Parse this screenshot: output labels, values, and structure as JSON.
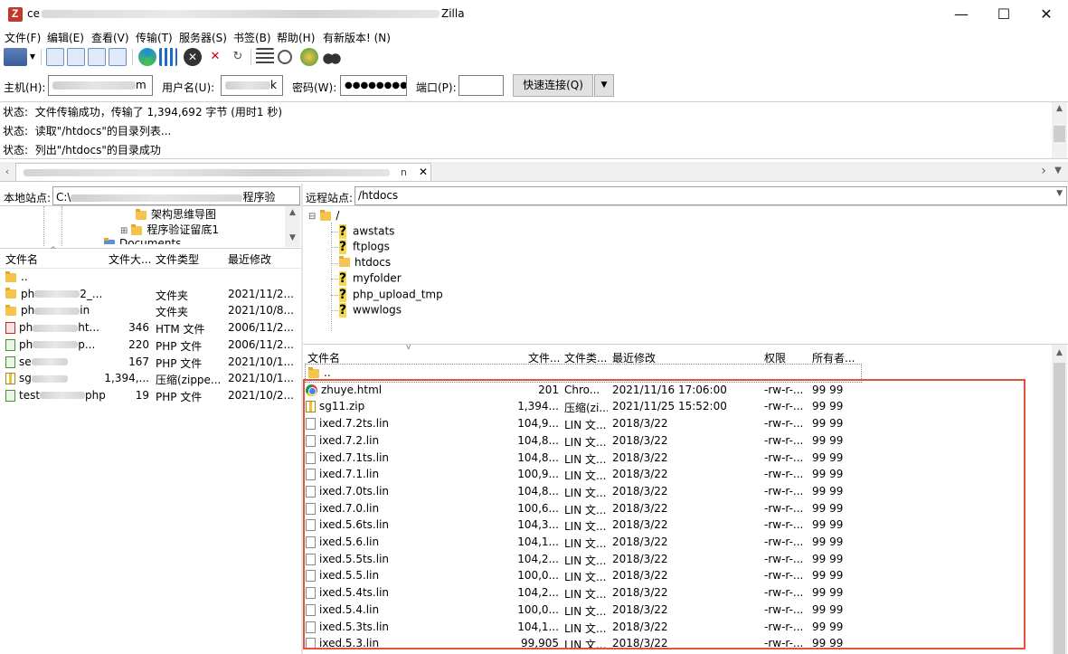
{
  "window": {
    "title_start": "ce",
    "title_end": "Zilla",
    "minimize": "—",
    "maximize": "☐",
    "close": "✕"
  },
  "menu": [
    {
      "label": "文件(F)"
    },
    {
      "label": "编辑(E)"
    },
    {
      "label": "查看(V)"
    },
    {
      "label": "传输(T)"
    },
    {
      "label": "服务器(S)"
    },
    {
      "label": "书签(B)"
    },
    {
      "label": "帮助(H)"
    },
    {
      "label": "有新版本! (N)"
    }
  ],
  "quickconnect": {
    "host_label": "主机(H):",
    "host_value_start": "",
    "host_value_end": "m",
    "user_label": "用户名(U):",
    "user_value_end": "k",
    "pass_label": "密码(W):",
    "pass_value": "●●●●●●●●",
    "port_label": "端口(P):",
    "port_value": "",
    "connect_button": "快速连接(Q)",
    "dropdown_arrow": "▼"
  },
  "log": [
    {
      "label": "状态:",
      "text": "文件传输成功，传输了 1,394,692 字节 (用时1 秒)"
    },
    {
      "label": "状态:",
      "text": "读取\"/htdocs\"的目录列表..."
    },
    {
      "label": "状态:",
      "text": "列出\"/htdocs\"的目录成功"
    }
  ],
  "tab": {
    "text_end": "n",
    "close": "✕"
  },
  "local": {
    "site_label": "本地站点:",
    "path_start": "C:\\",
    "path_end": "程序验",
    "tree": [
      {
        "name": "架构思维导图"
      },
      {
        "name": "程序验证留底1"
      },
      {
        "name": "Documents"
      }
    ],
    "columns": {
      "name": "文件名",
      "size": "文件大...",
      "type": "文件类型",
      "modified": "最近修改"
    },
    "files": [
      {
        "name_start": "",
        "name_end": "..",
        "size": "",
        "type": "",
        "modified": "",
        "icon": "folder"
      },
      {
        "name_start": "ph",
        "name_end": "2_...",
        "size": "",
        "type": "文件夹",
        "modified": "2021/11/2...",
        "icon": "folder"
      },
      {
        "name_start": "ph",
        "name_end": "in",
        "size": "",
        "type": "文件夹",
        "modified": "2021/10/8...",
        "icon": "folder"
      },
      {
        "name_start": "ph",
        "name_end": "ht...",
        "size": "346",
        "type": "HTM 文件",
        "modified": "2006/11/2...",
        "icon": "htm"
      },
      {
        "name_start": "ph",
        "name_end": "p...",
        "size": "220",
        "type": "PHP 文件",
        "modified": "2006/11/2...",
        "icon": "php"
      },
      {
        "name_start": "se",
        "name_end": "",
        "size": "167",
        "type": "PHP 文件",
        "modified": "2021/10/1...",
        "icon": "php"
      },
      {
        "name_start": "sg",
        "name_end": "",
        "size": "1,394,...",
        "type": "压缩(zippe...",
        "modified": "2021/10/1...",
        "icon": "zip"
      },
      {
        "name_start": "test",
        "name_end": "php",
        "size": "19",
        "type": "PHP 文件",
        "modified": "2021/10/2...",
        "icon": "php"
      }
    ]
  },
  "remote": {
    "site_label": "远程站点:",
    "path": "/htdocs",
    "tree_root": "/",
    "tree": [
      {
        "name": "awstats",
        "icon": "question"
      },
      {
        "name": "ftplogs",
        "icon": "question"
      },
      {
        "name": "htdocs",
        "icon": "folder"
      },
      {
        "name": "myfolder",
        "icon": "question"
      },
      {
        "name": "php_upload_tmp",
        "icon": "question"
      },
      {
        "name": "wwwlogs",
        "icon": "question"
      }
    ],
    "columns": {
      "name": "文件名",
      "size": "文件...",
      "type": "文件类...",
      "modified": "最近修改",
      "perms": "权限",
      "owner": "所有者..."
    },
    "files": [
      {
        "name": "..",
        "size": "",
        "type": "",
        "modified": "",
        "perms": "",
        "owner": "",
        "icon": "folder"
      },
      {
        "name": "zhuye.html",
        "size": "201",
        "type": "Chro...",
        "modified": "2021/11/16 17:06:00",
        "perms": "-rw-r-...",
        "owner": "99 99",
        "icon": "chrome"
      },
      {
        "name": "sg11.zip",
        "size": "1,394...",
        "type": "压缩(zi...",
        "modified": "2021/11/25 15:52:00",
        "perms": "-rw-r-...",
        "owner": "99 99",
        "icon": "zip"
      },
      {
        "name": "ixed.7.2ts.lin",
        "size": "104,9...",
        "type": "LIN 文...",
        "modified": "2018/3/22",
        "perms": "-rw-r-...",
        "owner": "99 99",
        "icon": "file"
      },
      {
        "name": "ixed.7.2.lin",
        "size": "104,8...",
        "type": "LIN 文...",
        "modified": "2018/3/22",
        "perms": "-rw-r-...",
        "owner": "99 99",
        "icon": "file"
      },
      {
        "name": "ixed.7.1ts.lin",
        "size": "104,8...",
        "type": "LIN 文...",
        "modified": "2018/3/22",
        "perms": "-rw-r-...",
        "owner": "99 99",
        "icon": "file"
      },
      {
        "name": "ixed.7.1.lin",
        "size": "100,9...",
        "type": "LIN 文...",
        "modified": "2018/3/22",
        "perms": "-rw-r-...",
        "owner": "99 99",
        "icon": "file"
      },
      {
        "name": "ixed.7.0ts.lin",
        "size": "104,8...",
        "type": "LIN 文...",
        "modified": "2018/3/22",
        "perms": "-rw-r-...",
        "owner": "99 99",
        "icon": "file"
      },
      {
        "name": "ixed.7.0.lin",
        "size": "100,6...",
        "type": "LIN 文...",
        "modified": "2018/3/22",
        "perms": "-rw-r-...",
        "owner": "99 99",
        "icon": "file"
      },
      {
        "name": "ixed.5.6ts.lin",
        "size": "104,3...",
        "type": "LIN 文...",
        "modified": "2018/3/22",
        "perms": "-rw-r-...",
        "owner": "99 99",
        "icon": "file"
      },
      {
        "name": "ixed.5.6.lin",
        "size": "104,1...",
        "type": "LIN 文...",
        "modified": "2018/3/22",
        "perms": "-rw-r-...",
        "owner": "99 99",
        "icon": "file"
      },
      {
        "name": "ixed.5.5ts.lin",
        "size": "104,2...",
        "type": "LIN 文...",
        "modified": "2018/3/22",
        "perms": "-rw-r-...",
        "owner": "99 99",
        "icon": "file"
      },
      {
        "name": "ixed.5.5.lin",
        "size": "100,0...",
        "type": "LIN 文...",
        "modified": "2018/3/22",
        "perms": "-rw-r-...",
        "owner": "99 99",
        "icon": "file"
      },
      {
        "name": "ixed.5.4ts.lin",
        "size": "104,2...",
        "type": "LIN 文...",
        "modified": "2018/3/22",
        "perms": "-rw-r-...",
        "owner": "99 99",
        "icon": "file"
      },
      {
        "name": "ixed.5.4.lin",
        "size": "100,0...",
        "type": "LIN 文...",
        "modified": "2018/3/22",
        "perms": "-rw-r-...",
        "owner": "99 99",
        "icon": "file"
      },
      {
        "name": "ixed.5.3ts.lin",
        "size": "104,1...",
        "type": "LIN 文...",
        "modified": "2018/3/22",
        "perms": "-rw-r-...",
        "owner": "99 99",
        "icon": "file"
      },
      {
        "name": "ixed.5.3.lin",
        "size": "99,905",
        "type": "LIN 文...",
        "modified": "2018/3/22",
        "perms": "-rw-r-...",
        "owner": "99 99",
        "icon": "file"
      }
    ]
  },
  "colors": {
    "highlight": "#e0553a",
    "folder": "#f4c44e"
  }
}
